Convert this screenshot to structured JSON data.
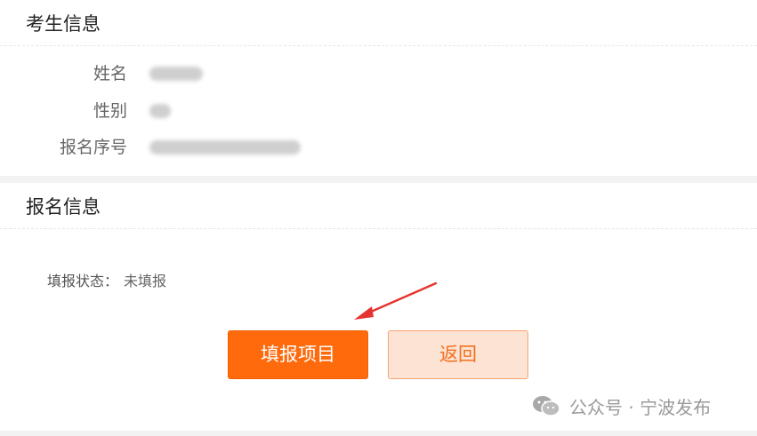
{
  "examinee_section": {
    "title": "考生信息",
    "fields": [
      {
        "label": "姓名"
      },
      {
        "label": "性别"
      },
      {
        "label": "报名序号"
      }
    ]
  },
  "registration_section": {
    "title": "报名信息",
    "status_label": "填报状态：",
    "status_value": "未填报",
    "fill_button": "填报项目",
    "back_button": "返回"
  },
  "watermark": {
    "text": "公众号 · 宁波发布"
  },
  "colors": {
    "primary_orange": "#fe6a0c",
    "secondary_bg": "#fde3d3",
    "secondary_text": "#f2701e",
    "annotation_arrow": "#e5342f"
  }
}
